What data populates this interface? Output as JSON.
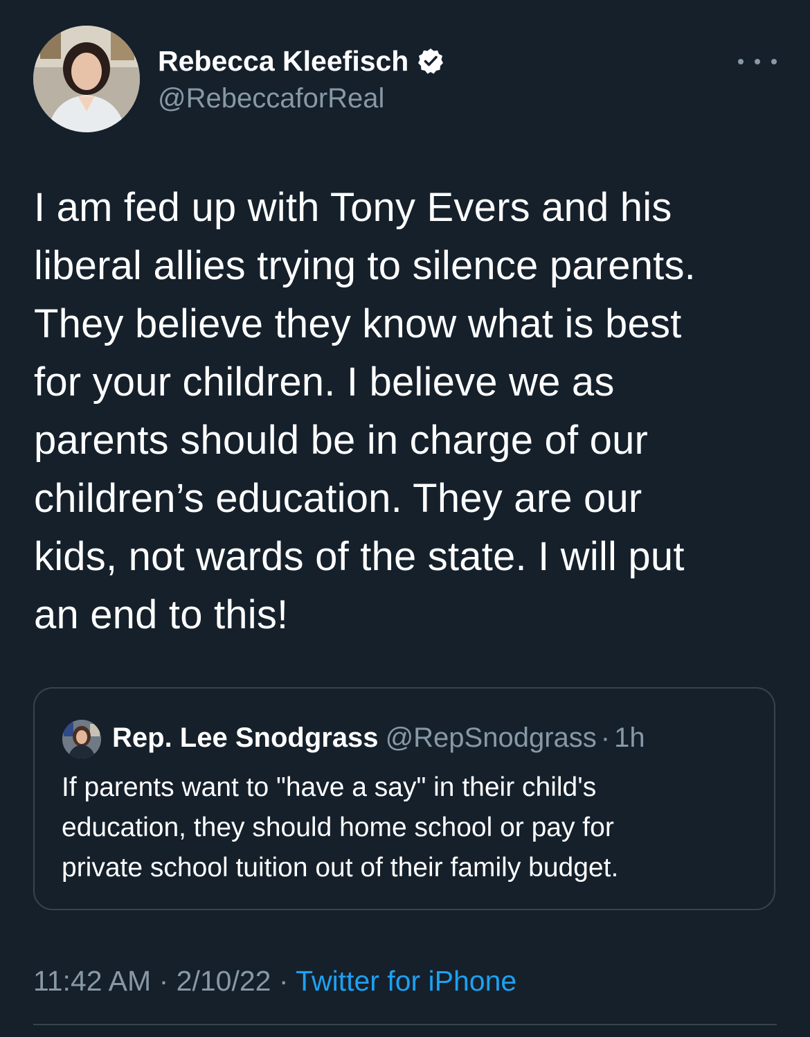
{
  "tweet": {
    "author": {
      "name": "Rebecca Kleefisch",
      "handle": "@RebeccaforReal",
      "verified": true
    },
    "text_lines": [
      "I am fed up with Tony Evers and his",
      "liberal allies trying to silence parents.",
      "They believe they know what is best",
      "for your children. I believe we as",
      "parents should be in charge of our",
      "children’s education. They are our",
      "kids, not wards of the state. I will put",
      "an end to this!"
    ],
    "quoted": {
      "name": "Rep. Lee Snodgrass",
      "handle": "@RepSnodgrass",
      "separator": "·",
      "time": "1h",
      "text_lines": [
        "If parents want to \"have a say\" in their child's",
        "education, they should home school or pay for",
        "private school tuition out of their family budget."
      ]
    },
    "meta": {
      "time": "11:42 AM",
      "separator": "·",
      "date": "2/10/22",
      "source": "Twitter for iPhone"
    }
  },
  "icons": {
    "verified": "verified-badge-icon",
    "more": "more-horizontal-icon"
  },
  "colors": {
    "background": "#15202b",
    "text_primary": "#ffffff",
    "text_secondary": "#8899a6",
    "accent": "#1da1f2",
    "border": "#38444d"
  }
}
